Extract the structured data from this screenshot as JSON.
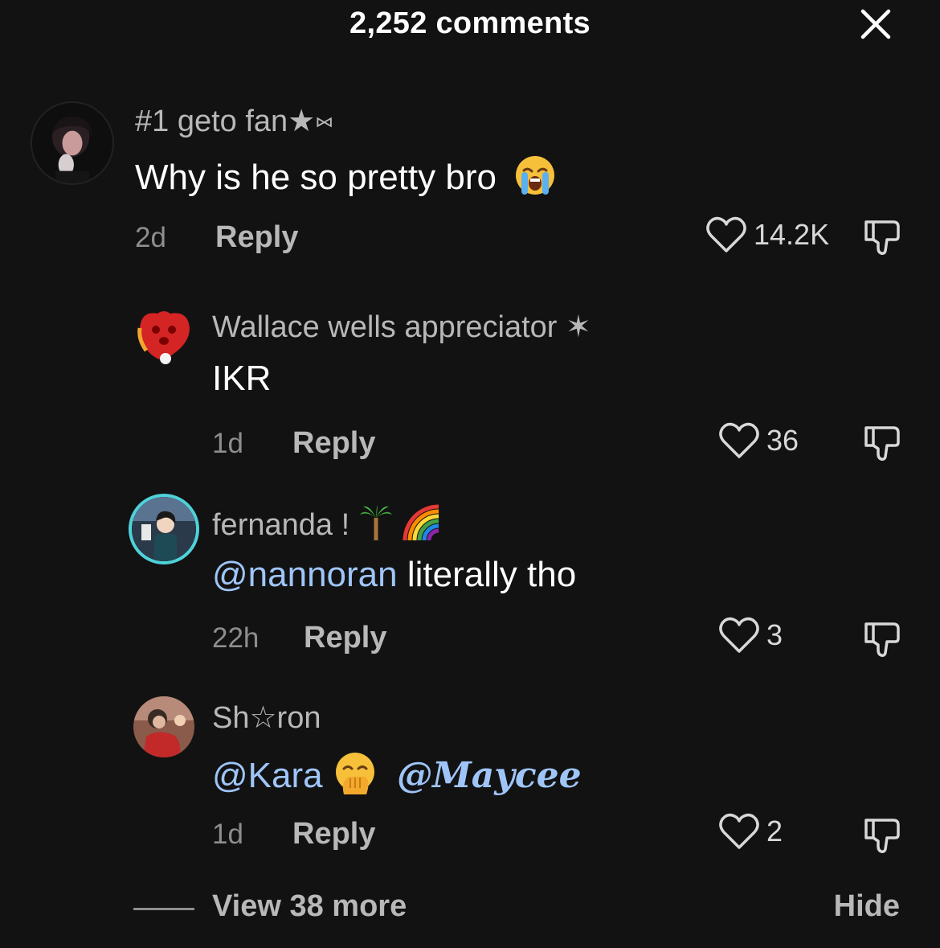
{
  "header": {
    "title": "2,252 comments",
    "close_icon": "close-icon"
  },
  "comments": [
    {
      "username": "#1 geto fan★⑅",
      "text": "Why is he so pretty bro",
      "emoji": "loudly-crying-face",
      "time": "2d",
      "reply_label": "Reply",
      "likes": "14.2K"
    },
    {
      "username": "Wallace wells appreciator ✶",
      "text": "IKR",
      "time": "1d",
      "reply_label": "Reply",
      "likes": "36"
    },
    {
      "username": "fernanda !",
      "username_emojis": [
        "palm-tree",
        "rainbow"
      ],
      "mention": "@nannoran",
      "text": " literally tho",
      "time": "22h",
      "reply_label": "Reply",
      "likes": "3"
    },
    {
      "username": "Sh☆ron",
      "mention1": "@Kara",
      "emoji": "face-with-hand-over-mouth",
      "mention2": "@Maycee",
      "time": "1d",
      "reply_label": "Reply",
      "likes": "2"
    }
  ],
  "footer": {
    "view_more": "View 38 more",
    "hide": "Hide"
  },
  "colors": {
    "background": "#121212",
    "mention": "#9fc5f8",
    "muted": "#8e8e8e"
  }
}
